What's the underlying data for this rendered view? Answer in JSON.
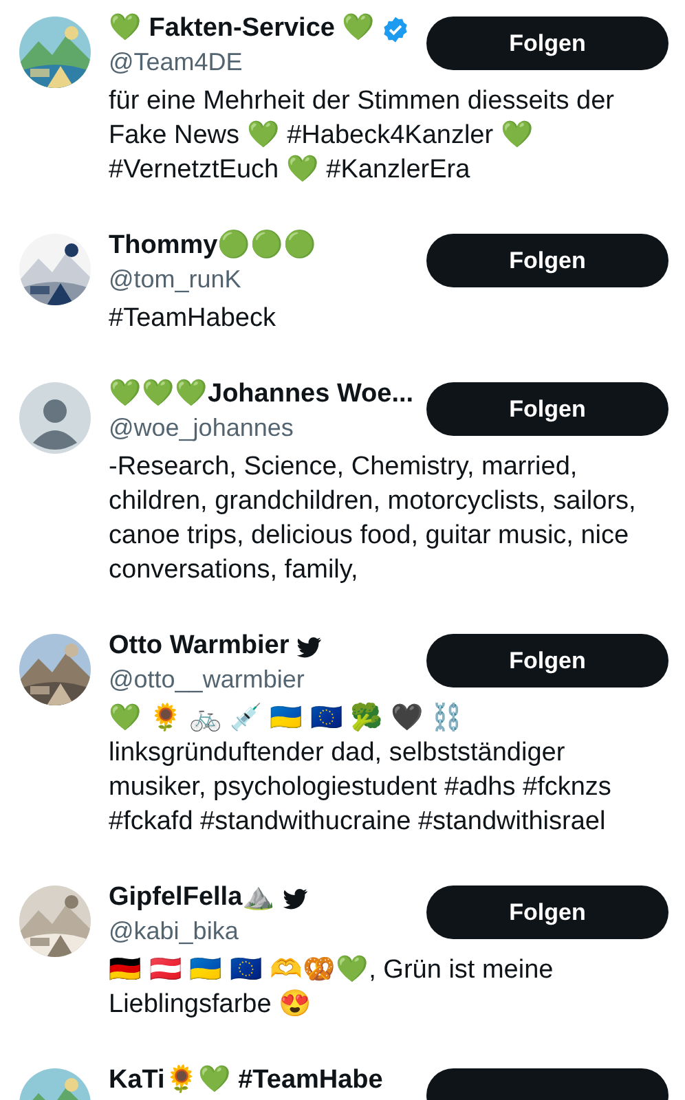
{
  "users": [
    {
      "name": "💚 Fakten-Service 💚",
      "verified": true,
      "bird": false,
      "handle": "@Team4DE",
      "bio": "für eine Mehrheit der Stimmen diesseits der Fake News 💚 #Habeck4Kanzler 💚 #VernetztEuch 💚 #KanzlerEra",
      "button": "Folgen"
    },
    {
      "name": "Thommy🟢🟢🟢",
      "verified": false,
      "bird": false,
      "handle": "@tom_runK",
      "bio": "#TeamHabeck",
      "button": "Folgen"
    },
    {
      "avatar": {
        "kind": "default"
      },
      "name": "💚💚💚Johannes Woe...",
      "verified": false,
      "bird": false,
      "handle": "@woe_johannes",
      "bio": "-Research, Science, Chemistry, married, children, grandchildren, motorcyclists, sailors, canoe trips, delicious food, guitar music, nice conversations, family,",
      "button": "Folgen"
    },
    {
      "name": "Otto Warmbier",
      "verified": false,
      "bird": true,
      "handle": "@otto__warmbier",
      "bio": "💚 🌻 🚲 💉 🇺🇦 🇪🇺 🥦 🖤 ⛓️\nlinksgründuftender dad, selbstständiger musiker, psychologiestudent #adhs #fcknzs #fckafd #standwithucraine #standwithisrael",
      "button": "Folgen"
    },
    {
      "name": "GipfelFella⛰️",
      "verified": false,
      "bird": true,
      "handle": "@kabi_bika",
      "bio": "🇩🇪 🇦🇹 🇺🇦 🇪🇺 🫶🥨💚, Grün ist meine Lieblingsfarbe 😍",
      "button": "Folgen"
    },
    {
      "name": "KaTi🌻💚 #TeamHabe",
      "verified": false,
      "bird": false
    }
  ]
}
